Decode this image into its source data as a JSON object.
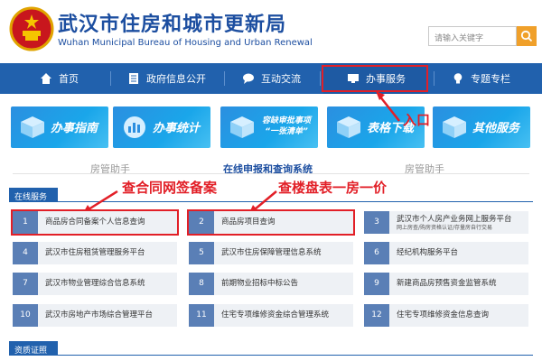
{
  "header": {
    "title_cn": "武汉市住房和城市更新局",
    "title_en": "Wuhan Municipal Bureau of Housing and Urban Renewal",
    "search_placeholder": "请输入关键字"
  },
  "nav": {
    "items": [
      {
        "label": "首页",
        "icon": "home-icon"
      },
      {
        "label": "政府信息公开",
        "icon": "document-icon"
      },
      {
        "label": "互动交流",
        "icon": "chat-bubble-icon"
      },
      {
        "label": "办事服务",
        "icon": "monitor-icon"
      },
      {
        "label": "专题专栏",
        "icon": "bulb-icon"
      }
    ]
  },
  "tiles": [
    {
      "label": "办事指南"
    },
    {
      "label": "办事统计"
    },
    {
      "label_line1": "容缺审批事项",
      "label_line2": "“一张清单”"
    },
    {
      "label": "表格下载"
    },
    {
      "label": "其他服务"
    }
  ],
  "annotations": {
    "entry": "入口",
    "contract": "查合同网签备案",
    "building": "查楼盘表一房一价"
  },
  "subnav": {
    "left": "房管助手",
    "center": "在线申报和查询系统",
    "right": "房管助手"
  },
  "sections": {
    "online": "在线服务",
    "qualification": "资质证照"
  },
  "services": [
    {
      "num": "1",
      "label": "商品房合同备案个人信息查询"
    },
    {
      "num": "2",
      "label": "商品房项目查询"
    },
    {
      "num": "3",
      "label": "武汉市个人房产业务网上服务平台",
      "sub": "网上房查/购房资格认证/存量房自行交易"
    },
    {
      "num": "4",
      "label": "武汉市住房租赁管理服务平台"
    },
    {
      "num": "5",
      "label": "武汉市住房保障管理信息系统"
    },
    {
      "num": "6",
      "label": "经纪机构服务平台"
    },
    {
      "num": "7",
      "label": "武汉市物业管理综合信息系统"
    },
    {
      "num": "8",
      "label": "前期物业招标中标公告"
    },
    {
      "num": "9",
      "label": "新建商品房预售资金监管系统"
    },
    {
      "num": "10",
      "label": "武汉市房地产市场综合管理平台"
    },
    {
      "num": "11",
      "label": "住宅专项维修资金综合管理系统"
    },
    {
      "num": "12",
      "label": "住宅专项维修资金信息查询"
    }
  ],
  "colors": {
    "brand_blue": "#2161ad",
    "annotation_red": "#e21f27",
    "search_orange": "#f0a02a"
  }
}
